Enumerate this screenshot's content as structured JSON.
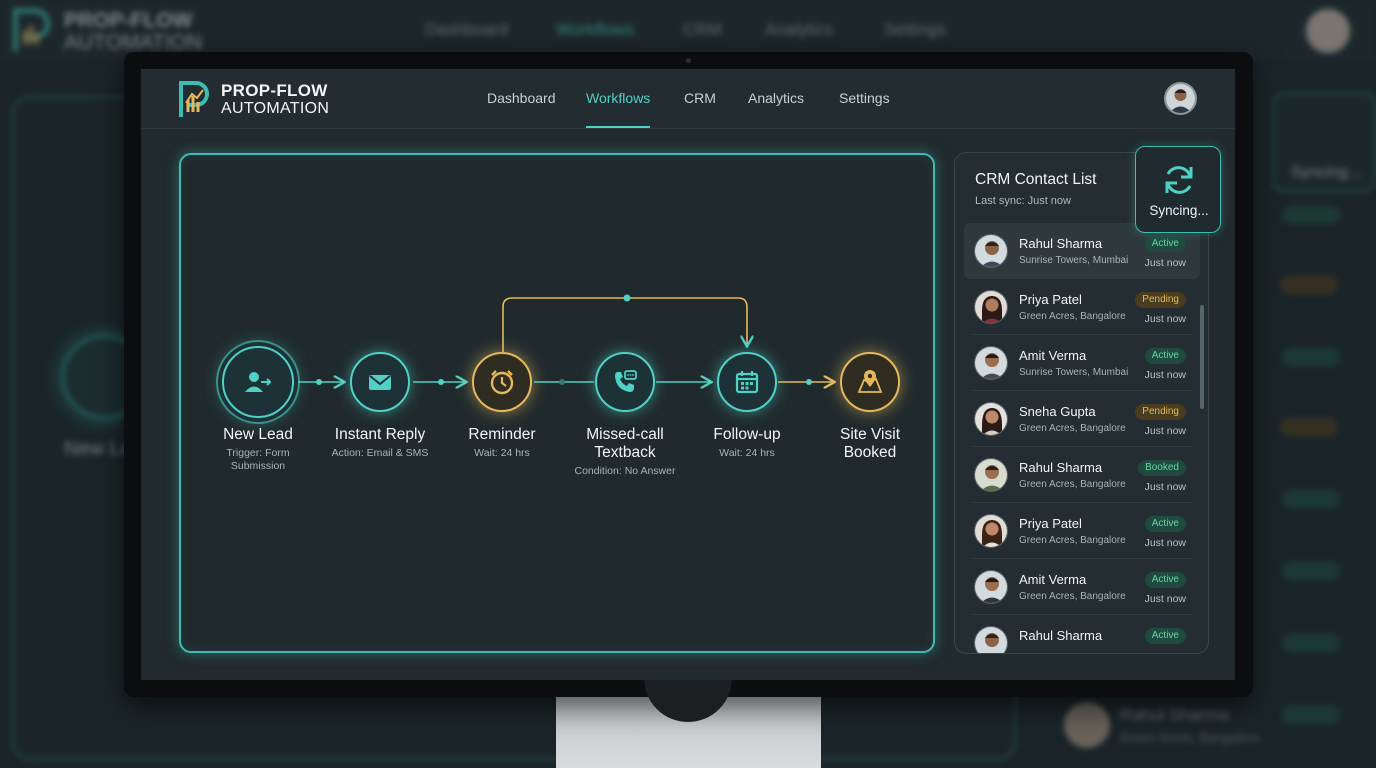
{
  "brand": {
    "title": "PROP-FLOW",
    "subtitle": "AUTOMATION",
    "accent_color": "#4fd1c5",
    "gold_color": "#e6b85c"
  },
  "nav": {
    "items": [
      {
        "label": "Dashboard"
      },
      {
        "label": "Workflows"
      },
      {
        "label": "CRM"
      },
      {
        "label": "Analytics"
      },
      {
        "label": "Settings"
      }
    ],
    "active": "Workflows"
  },
  "workflow": {
    "nodes": [
      {
        "title": "New Lead",
        "subtitle": "Trigger: Form Submission",
        "icon": "user-arrow-icon",
        "color": "teal"
      },
      {
        "title": "Instant Reply",
        "subtitle": "Action: Email & SMS",
        "icon": "mail-icon",
        "color": "teal"
      },
      {
        "title": "Reminder",
        "subtitle": "Wait: 24 hrs",
        "icon": "alarm-clock-icon",
        "color": "gold"
      },
      {
        "title": "Missed-call Textback",
        "subtitle": "Condition: No Answer",
        "icon": "phone-message-icon",
        "color": "teal"
      },
      {
        "title": "Follow-up",
        "subtitle": "Wait: 24 hrs",
        "icon": "calendar-icon",
        "color": "teal"
      },
      {
        "title": "Site Visit Booked",
        "subtitle": "",
        "icon": "map-pin-icon",
        "color": "gold"
      }
    ]
  },
  "crm": {
    "title": "CRM Contact List",
    "last_sync": "Last sync: Just now",
    "sync_button": "Syncing...",
    "contacts": [
      {
        "name": "Rahul Sharma",
        "location": "Sunrise Towers, Mumbai",
        "status": "Active",
        "time": "Just now"
      },
      {
        "name": "Priya Patel",
        "location": "Green Acres, Bangalore",
        "status": "Pending",
        "time": "Just now"
      },
      {
        "name": "Amit Verma",
        "location": "Sunrise Towers, Mumbai",
        "status": "Active",
        "time": "Just now"
      },
      {
        "name": "Sneha Gupta",
        "location": "Green Acres, Bangalore",
        "status": "Pending",
        "time": "Just now"
      },
      {
        "name": "Rahul Sharma",
        "location": "Green Acres, Bangalore",
        "status": "Booked",
        "time": "Just now"
      },
      {
        "name": "Priya Patel",
        "location": "Green Acres, Bangalore",
        "status": "Active",
        "time": "Just now"
      },
      {
        "name": "Amit Verma",
        "location": "Green Acres, Bangalore",
        "status": "Active",
        "time": "Just now"
      },
      {
        "name": "Rahul Sharma",
        "location": "",
        "status": "Active",
        "time": ""
      }
    ]
  },
  "background": {
    "node_label": "New Lead",
    "sync_label": "Syncing...",
    "row_name": "Rahul Sharma",
    "row_location": "Green Acres, Bangalore"
  }
}
